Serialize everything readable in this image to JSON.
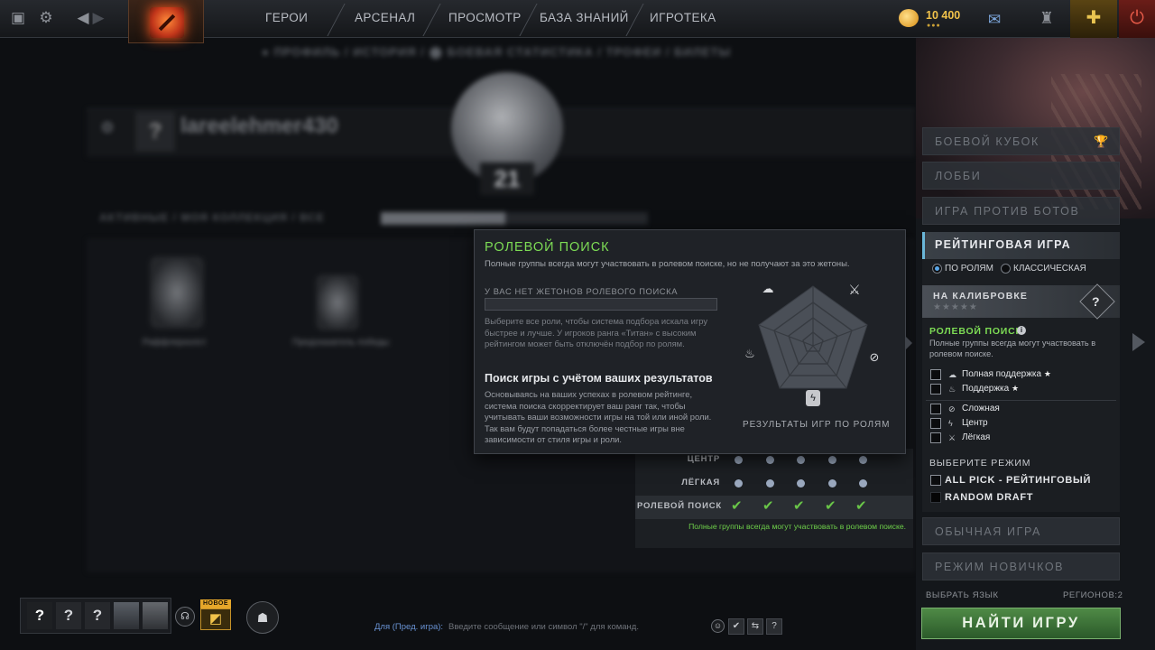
{
  "topbar": {
    "nav": [
      "ГЕРОИ",
      "АРСЕНАЛ",
      "ПРОСМОТР",
      "БАЗА ЗНАНИЙ",
      "ИГРОТЕКА"
    ],
    "currency": "10 400"
  },
  "background": {
    "subnav": "● ПРОФИЛЬ  /  ИСТОРИЯ  /  ⬤ БОЕВАЯ СТАТИСТИКА  /  ТРОФЕИ  /  БИЛЕТЫ",
    "username": "lareelehmer430",
    "badge_level": "21",
    "tabs": "АКТИВНЫЕ  /  МОЯ КОЛЛЕКЦИЯ  /  ВСЕ",
    "trophy1": "Раффлерхолст",
    "trophy2": "Предсказатель победы"
  },
  "role_table": {
    "rows": [
      {
        "label": "ЦЕНТР",
        "marks": [
          "dot",
          "dot",
          "dot",
          "dot",
          "dot"
        ]
      },
      {
        "label": "ЛЁГКАЯ",
        "marks": [
          "dot",
          "dot",
          "dot",
          "dot",
          "dot"
        ]
      },
      {
        "label": "РОЛЕВОЙ ПОИСК",
        "marks": [
          "check",
          "check",
          "check",
          "check",
          "check"
        ]
      }
    ],
    "note": "Полные группы всегда могут участвовать в ролевом поиске."
  },
  "tooltip": {
    "title": "РОЛЕВОЙ ПОИСК",
    "desc": "Полные группы всегда могут участвовать в ролевом поиске, но не получают за это жетоны.",
    "no_tokens": "У ВАС НЕТ ЖЕТОНОВ РОЛЕВОГО ПОИСКА",
    "para1": "Выберите все роли, чтобы система подбора искала игру быстрее и лучше. У игроков ранга «Титан» с высоким рейтингом может быть отключён подбор по ролям.",
    "heading2": "Поиск игры с учётом ваших результатов",
    "para2": "Основываясь на ваших успехах в ролевом рейтинге, система поиска скорректирует ваш ранг так, чтобы учитывать ваши возможности игры на той или иной роли. Так вам будут попадаться более честные игры вне зависимости от стиля игры и роли.",
    "radar_label": "РЕЗУЛЬТАТЫ ИГР ПО РОЛЯМ"
  },
  "right_panel": {
    "battle_cup": "БОЕВОЙ КУБОК",
    "lobby": "ЛОББИ",
    "bots": "ИГРА ПРОТИВ БОТОВ",
    "ranked": "РЕЙТИНГОВАЯ ИГРА",
    "by_roles": "ПО РОЛЯМ",
    "classic": "КЛАССИЧЕСКАЯ",
    "calibration": "НА КАЛИБРОВКЕ",
    "calibration_stars": "★★★★★",
    "role_search_title": "РОЛЕВОЙ ПОИСК",
    "role_search_desc": "Полные группы всегда могут участвовать в ролевом поиске.",
    "roles": [
      {
        "label": "Полная поддержка",
        "star": "★"
      },
      {
        "label": "Поддержка",
        "star": "★"
      },
      {
        "label": "Сложная",
        "star": ""
      },
      {
        "label": "Центр",
        "star": ""
      },
      {
        "label": "Лёгкая",
        "star": ""
      }
    ],
    "select_mode": "ВЫБЕРИТЕ РЕЖИМ",
    "mode_all_pick": "ALL PICK - РЕЙТИНГОВЫЙ",
    "mode_random": "RANDOM DRAFT",
    "normal": "ОБЫЧНАЯ ИГРА",
    "newbie": "РЕЖИМ НОВИЧКОВ",
    "language": "ВЫБРАТЬ ЯЗЫК",
    "regions": "РЕГИОНОВ:2",
    "find_game": "НАЙТИ ИГРУ"
  },
  "bottom": {
    "party_slot": "?",
    "new_tag": "НОВОЕ",
    "chat_channel": "Для (Пред. игра):",
    "chat_hint": "Введите сообщение или символ \"/\" для команд.",
    "help": "?"
  }
}
